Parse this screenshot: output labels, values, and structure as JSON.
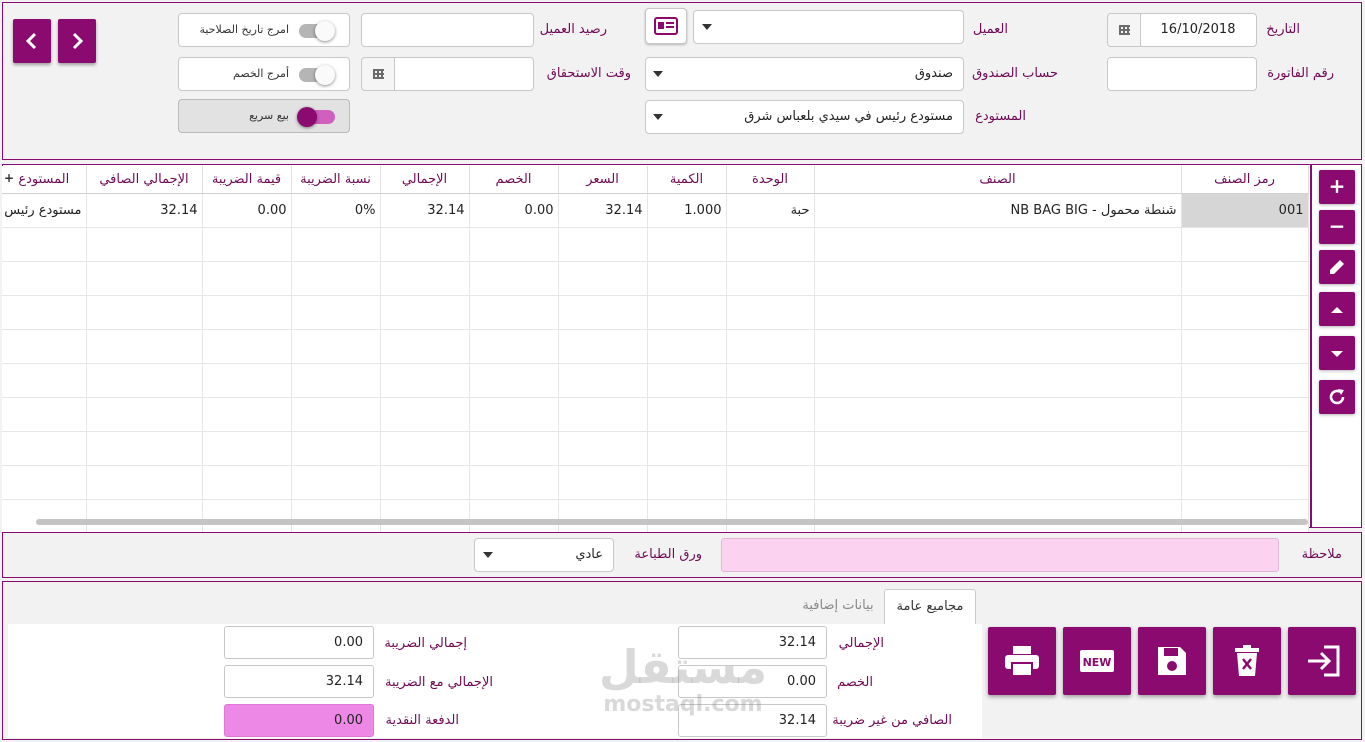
{
  "header": {
    "date_label": "التاريخ",
    "date_value": "16/10/2018",
    "invoice_no_label": "رقم الفاتورة",
    "invoice_no_value": "",
    "customer_label": "العميل",
    "customer_value": "",
    "cashbox_label": "حساب الصندوق",
    "cashbox_value": "صندوق",
    "warehouse_label": "المستودع",
    "warehouse_value": "مستودع رئيس في سيدي بلعباس شرق",
    "balance_label": "رصيد العميل",
    "balance_value": "",
    "due_label": "وقت الاستحقاق",
    "due_value": "",
    "toggle_expiry": "امرج تاريخ الصلاحية",
    "toggle_discount": "أمرج الخصم",
    "toggle_quick_sale": "بيع سريع",
    "toggle_expiry_on": false,
    "toggle_discount_on": false,
    "toggle_quick_sale_on": true
  },
  "table": {
    "columns": [
      "المستودع",
      "الإجمالي الصافي",
      "قيمة الضريبة",
      "نسبة الضريبة",
      "الإجمالي",
      "الخصم",
      "السعر",
      "الكمية",
      "الوحدة",
      "الصنف",
      "رمز الصنف"
    ],
    "rows": [
      [
        "مستودع رئيس",
        "32.14",
        "0.00",
        "0%",
        "32.14",
        "0.00",
        "32.14",
        "1.000",
        "حبة",
        "شنطة محمول - NB BAG BIG",
        "001"
      ]
    ]
  },
  "notes": {
    "note_label": "ملاحظة",
    "note_value": "",
    "paper_label": "ورق الطباعة",
    "paper_value": "عادي"
  },
  "tabs": {
    "general": "مجاميع عامة",
    "extra": "بيانات إضافية"
  },
  "totals": {
    "total_label": "الإجمالي",
    "total_value": "32.14",
    "discount_label": "الخصم",
    "discount_value": "0.00",
    "net_no_tax_label": "الصافي من غير ضريبة",
    "net_no_tax_value": "32.14",
    "tax_total_label": "إجمالي الضريبة",
    "tax_total_value": "0.00",
    "total_with_tax_label": "الإجمالي مع الضريبة",
    "total_with_tax_value": "32.14",
    "cash_payment_label": "الدفعة النقدية",
    "cash_payment_value": "0.00"
  },
  "watermark": {
    "arabic": "مستقل",
    "latin": "mostaql.com"
  },
  "colors": {
    "accent": "#8b0a6f",
    "note_bg": "#fbd3f0",
    "cash_bg": "#ee88e6"
  }
}
